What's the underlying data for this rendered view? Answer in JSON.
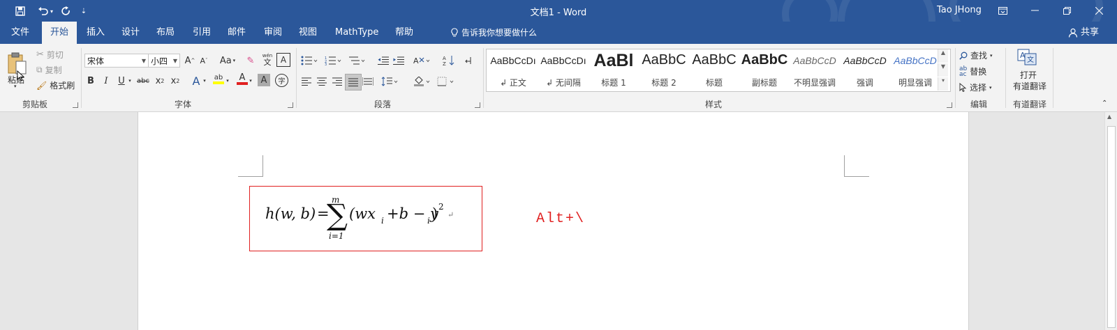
{
  "titlebar": {
    "doc_title": "文档1  -  Word",
    "user": "Tao JHong",
    "save_icon": "save-icon",
    "undo_icon": "undo-icon",
    "redo_icon": "redo-icon"
  },
  "tabs": [
    "文件",
    "开始",
    "插入",
    "设计",
    "布局",
    "引用",
    "邮件",
    "审阅",
    "视图",
    "MathType",
    "帮助"
  ],
  "tell_me": "告诉我你想要做什么",
  "share": "共享",
  "clipboard": {
    "paste": "粘贴",
    "cut": "剪切",
    "copy": "复制",
    "format_painter": "格式刷",
    "group": "剪贴板"
  },
  "font": {
    "name": "宋体",
    "size": "小四",
    "group": "字体",
    "phonetic_top": "wén",
    "phonetic_char": "文"
  },
  "paragraph": {
    "group": "段落"
  },
  "styles": {
    "group": "样式",
    "items": [
      {
        "sample": "AaBbCcDı",
        "name": "↲ 正文"
      },
      {
        "sample": "AaBbCcDı",
        "name": "↲ 无间隔"
      },
      {
        "sample": "AaBl",
        "name": "标题 1"
      },
      {
        "sample": "AaBbC",
        "name": "标题 2"
      },
      {
        "sample": "AaBbC",
        "name": "标题"
      },
      {
        "sample": "AaBbC",
        "name": "副标题"
      },
      {
        "sample": "AaBbCcD",
        "name": "不明显强调"
      },
      {
        "sample": "AaBbCcD",
        "name": "强调"
      },
      {
        "sample": "AaBbCcD",
        "name": "明显强调"
      }
    ]
  },
  "editing": {
    "find": "查找",
    "replace": "替换",
    "select": "选择",
    "group": "编辑"
  },
  "youdao": {
    "open": "打开",
    "translate": "有道翻译",
    "group": "有道翻译"
  },
  "document": {
    "equation": {
      "lhs": "h(w, b)",
      "eq": "=",
      "sigma": "∑",
      "upper": "m",
      "lower": "i=1",
      "body": "(wx",
      "sub_i": "i",
      "mid": "+b − y",
      "sub_i2": "i",
      "close": ")",
      "sup": "2",
      "para_mark": "↵"
    },
    "hint": "Alt+\\"
  },
  "colors": {
    "brand": "#2b579a",
    "annotation_red": "#e02020",
    "title_style_blue": "#2b579a"
  }
}
